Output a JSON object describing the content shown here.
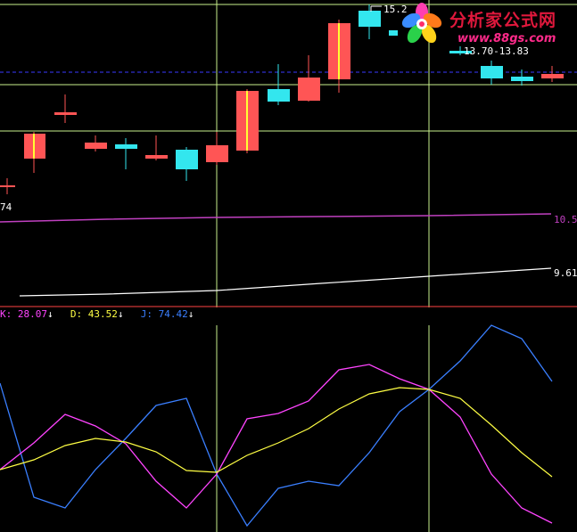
{
  "colors": {
    "up": "#ff5555",
    "down": "#33e6ee",
    "up_body_line": "#ffff33",
    "grid": "#c8f08c",
    "separator": "#ff4444",
    "purple_line": "#c040c0",
    "white_line": "#ffffff",
    "dashed_line": "#3a3aff",
    "k_line": "#ff44ff",
    "d_line": "#ffff44",
    "j_line": "#3a7fff"
  },
  "labels": {
    "price_high": "15.2",
    "price_range": "13.70-13.83",
    "price_low": "74",
    "ma_purple": "10.5",
    "ma_white": "9.61"
  },
  "indicator": {
    "k_label": "K: 28.07",
    "d_label": "D: 43.52",
    "j_label": "J: 74.42",
    "arrow": "↓",
    "k_color": "#ff44ff",
    "d_color": "#ffff44",
    "j_color": "#3a7fff"
  },
  "watermark": {
    "title": "分析家公式网",
    "url": "www.88gs.com",
    "logo": "flower-logo"
  }
}
